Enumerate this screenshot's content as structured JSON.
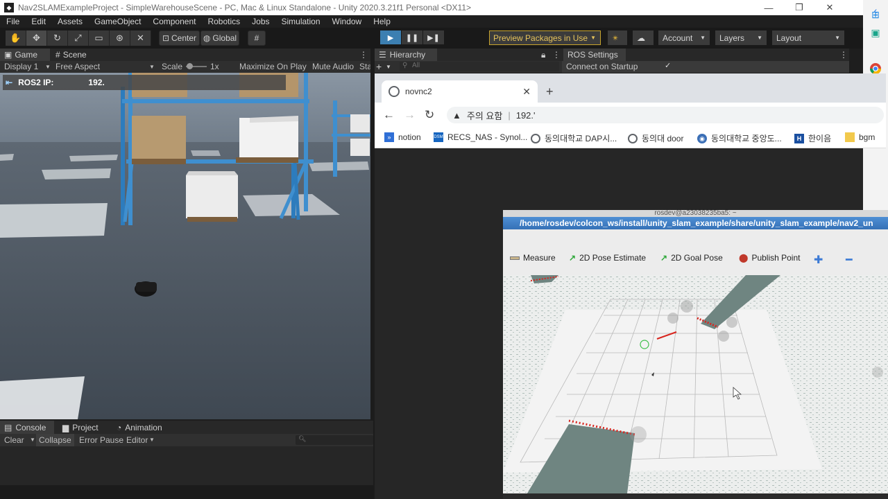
{
  "window": {
    "title": "Nav2SLAMExampleProject - SimpleWarehouseScene - PC, Mac & Linux Standalone - Unity 2020.3.21f1 Personal <DX11>",
    "minimize": "—",
    "restore": "❐",
    "close": "✕"
  },
  "menu": [
    "File",
    "Edit",
    "Assets",
    "GameObject",
    "Component",
    "Robotics",
    "Jobs",
    "Simulation",
    "Window",
    "Help"
  ],
  "toolbar": {
    "center_label": "Center",
    "global_label": "Global",
    "preview_packages": "Preview Packages in Use",
    "account": "Account",
    "layers": "Layers",
    "layout": "Layout"
  },
  "game_panel": {
    "tab_game": "Game",
    "tab_scene": "Scene",
    "display": "Display 1",
    "aspect": "Free Aspect",
    "scale_label": "Scale",
    "scale_value": "1x",
    "maximize": "Maximize On Play",
    "mute": "Mute Audio",
    "stats": "Sta",
    "ros_ip_label": "ROS2 IP:",
    "ros_ip_value": "192."
  },
  "console_panel": {
    "tab_console": "Console",
    "tab_project": "Project",
    "tab_animation": "Animation",
    "clear": "Clear",
    "collapse": "Collapse",
    "error_pause": "Error Pause",
    "editor": "Editor"
  },
  "hierarchy_panel": {
    "tab_hierarchy": "Hierarchy",
    "tab_ros": "ROS Settings",
    "search_placeholder": "All",
    "connect_on_startup": "Connect on Startup",
    "connect_checked": "✓"
  },
  "browser": {
    "tab_title": "novnc2",
    "security_warning": "주의 요함",
    "address": "192.'",
    "bookmarks": [
      {
        "label": "notion",
        "color": "#2f6fd6"
      },
      {
        "label": "RECS_NAS - Synol...",
        "color": "#1565c0"
      },
      {
        "label": "동의대학교 DAP시...",
        "color": "#5f6368"
      },
      {
        "label": "동의대 door",
        "color": "#5f6368"
      },
      {
        "label": "동의대학교 중앙도...",
        "color": "#3b6fb6"
      },
      {
        "label": "한이음",
        "color": "#1a4fa0"
      },
      {
        "label": "bgm",
        "color": "#f2c94c"
      }
    ]
  },
  "rviz": {
    "terminal_title": "rosdev@a23038235ba5: ~",
    "path": "/home/rosdev/colcon_ws/install/unity_slam_example/share/unity_slam_example/nav2_un",
    "tools": [
      "Measure",
      "2D Pose Estimate",
      "2D Goal Pose",
      "Publish Point"
    ]
  },
  "colors": {
    "unity_bg": "#1e1e1e",
    "play_active": "#3c7fb1",
    "preview_accent": "#e6c35c",
    "rviz_title": "#3571b7"
  }
}
